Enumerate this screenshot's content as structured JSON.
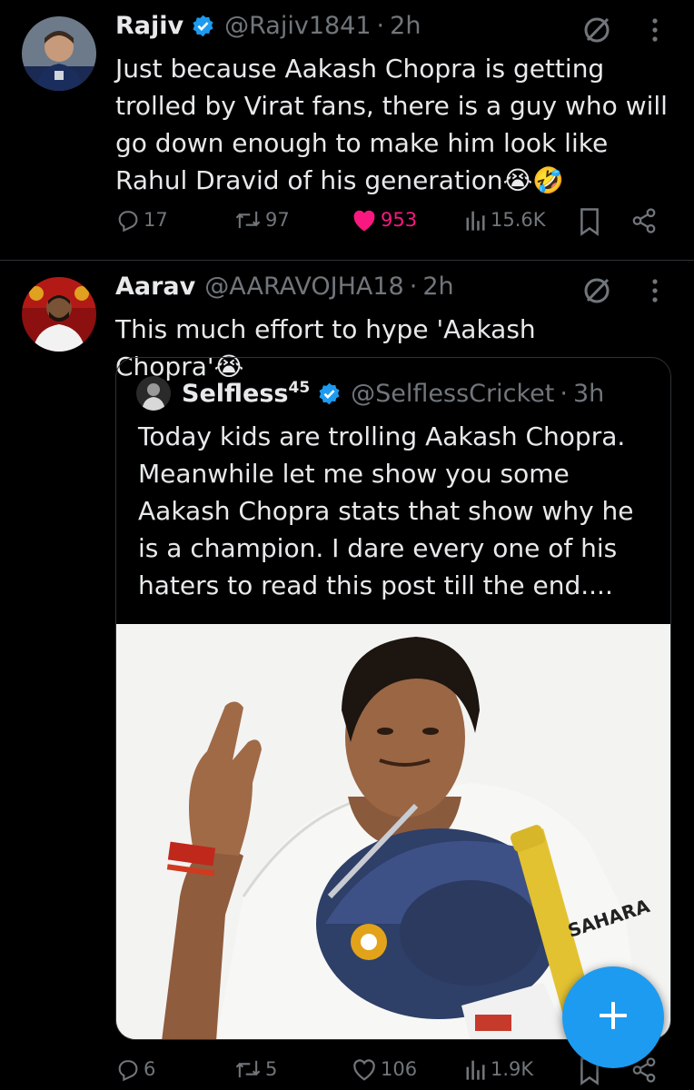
{
  "tweets": [
    {
      "name": "Rajiv",
      "handle": "@Rajiv1841",
      "dot": "·",
      "time": "2h",
      "text": "Just because Aakash Chopra is getting trolled by Virat fans, there is a guy who will go down enough to make him look like Rahul Dravid of his generation😭🤣",
      "replies": "17",
      "reposts": "97",
      "likes": "953",
      "views": "15.6K",
      "liked": true,
      "verified": true
    },
    {
      "name": "Aarav",
      "handle": "@AARAVOJHA18",
      "dot": "·",
      "time": "2h",
      "text": "This much effort to hype 'Aakash Chopra'😭",
      "replies": "6",
      "reposts": "5",
      "likes": "106",
      "views": "1.9K",
      "liked": false,
      "verified": false,
      "quote": {
        "name": "Selfless",
        "name_sup": "45",
        "handle": "@SelflessCricket",
        "dot": "·",
        "time": "3h",
        "verified": true,
        "text": "Today kids are trolling Aakash Chopra. Meanwhile let me show you some Aakash Chopra stats that show why he is a champion. I dare every one of his haters to read this post till the end....",
        "image_alt": "cricketer holding helmet and bat, saluting",
        "image_text": "SAHARA"
      }
    }
  ],
  "fab": {
    "icon": "plus-icon"
  },
  "colors": {
    "accent": "#1d9bf0",
    "like": "#f91880",
    "muted": "#71767b",
    "text": "#e7e9ea",
    "background": "#000000"
  }
}
